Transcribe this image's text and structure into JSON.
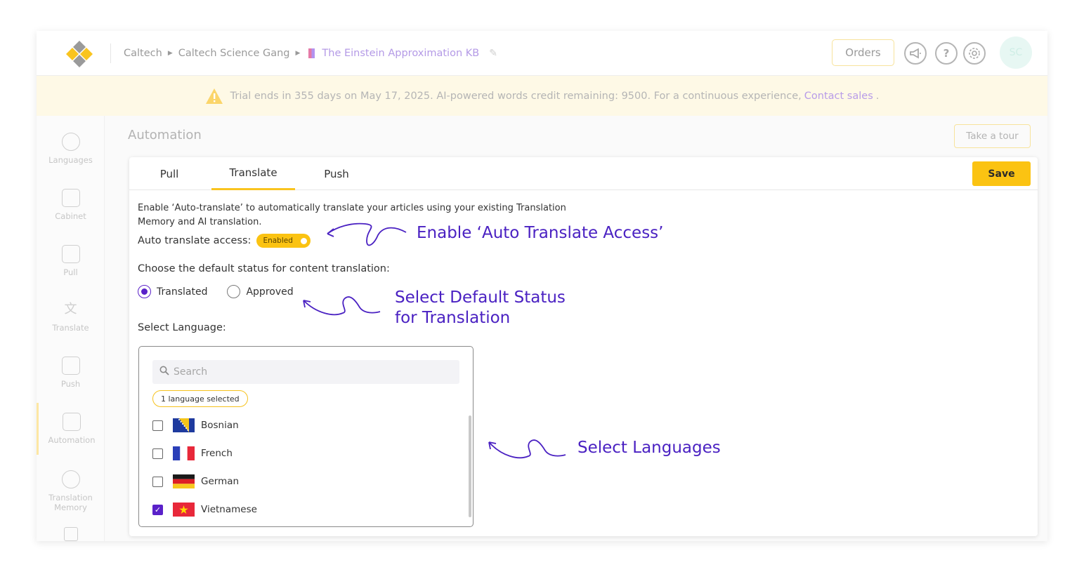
{
  "header": {
    "breadcrumbs": [
      "Caltech",
      "Caltech Science Gang"
    ],
    "kb_name": "The Einstein Approximation KB",
    "orders_label": "Orders",
    "avatar_initials": "SC",
    "icons": [
      "megaphone-icon",
      "help-icon",
      "settings-icon"
    ]
  },
  "banner": {
    "text": "Trial ends in 355 days on May 17, 2025. AI-powered words credit remaining: 9500. For a continuous experience,",
    "link": "Contact sales",
    "suffix": "."
  },
  "sidebar": {
    "items": [
      {
        "label": "Languages",
        "icon": "languages-icon"
      },
      {
        "label": "Cabinet",
        "icon": "cabinet-icon"
      },
      {
        "label": "Pull",
        "icon": "pull-icon"
      },
      {
        "label": "Translate",
        "icon": "translate-icon"
      },
      {
        "label": "Push",
        "icon": "push-icon"
      },
      {
        "label": "Automation",
        "icon": "automation-icon",
        "active": true
      },
      {
        "label": "Translation Memory",
        "icon": "translation-memory-icon"
      }
    ]
  },
  "page": {
    "title": "Automation",
    "tour_label": "Take a tour"
  },
  "tabs": [
    {
      "label": "Pull"
    },
    {
      "label": "Translate",
      "active": true
    },
    {
      "label": "Push"
    }
  ],
  "save_label": "Save",
  "translate": {
    "description": "Enable ‘Auto-translate’ to automatically translate your articles using your existing Translation Memory and AI translation.",
    "auto_label": "Auto translate access:",
    "toggle_text": "Enabled",
    "status_question": "Choose the default status for content translation:",
    "status_options": [
      {
        "label": "Translated",
        "checked": true
      },
      {
        "label": "Approved",
        "checked": false
      }
    ],
    "language_label": "Select Language:",
    "search_placeholder": "Search",
    "selected_chip": "1 language selected",
    "languages": [
      {
        "name": "Bosnian",
        "checked": false
      },
      {
        "name": "French",
        "checked": false
      },
      {
        "name": "German",
        "checked": false
      },
      {
        "name": "Vietnamese",
        "checked": true
      }
    ]
  },
  "annotations": {
    "auto_translate": "Enable ‘Auto Translate Access’",
    "status_line1": "Select Default Status",
    "status_line2": "for Translation",
    "languages": "Select Languages"
  },
  "colors": {
    "accent": "#fbc312",
    "annotation": "#4a21c2",
    "check": "#5a21c9"
  }
}
